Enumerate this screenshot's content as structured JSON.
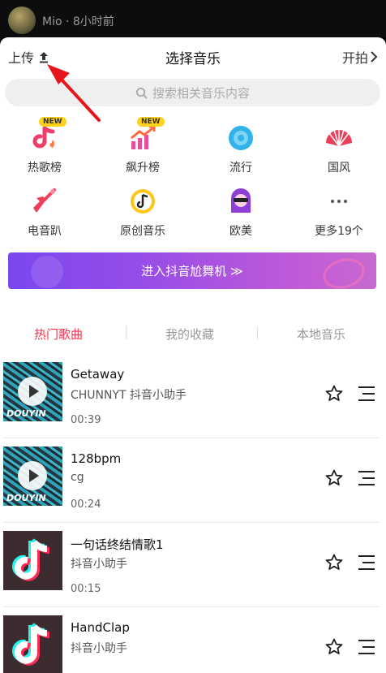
{
  "topbar": {
    "username": "Mio · 8小时前"
  },
  "header": {
    "upload_label": "上传",
    "title": "选择音乐",
    "start_label": "开拍"
  },
  "search": {
    "placeholder": "搜索相关音乐内容"
  },
  "categories": [
    {
      "label": "热歌榜",
      "badge": "NEW",
      "icon": "hot-chart-icon"
    },
    {
      "label": "飙升榜",
      "badge": "NEW",
      "icon": "rising-chart-icon"
    },
    {
      "label": "流行",
      "icon": "pop-icon"
    },
    {
      "label": "国风",
      "icon": "chinese-fan-icon"
    },
    {
      "label": "电音趴",
      "icon": "guitar-icon"
    },
    {
      "label": "原创音乐",
      "icon": "original-music-icon"
    },
    {
      "label": "欧美",
      "icon": "western-icon"
    },
    {
      "label": "更多19个",
      "icon": "more-icon"
    }
  ],
  "banner": {
    "label": "进入抖音尬舞机 ≫"
  },
  "tabs": [
    {
      "label": "热门歌曲",
      "active": true
    },
    {
      "label": "我的收藏",
      "active": false
    },
    {
      "label": "本地音乐",
      "active": false
    }
  ],
  "songs": [
    {
      "title": "Getaway",
      "artist": "CHUNNYT 抖音小助手",
      "duration": "00:39",
      "cover": "douyin",
      "watermark": "DOUYIN"
    },
    {
      "title": "128bpm",
      "artist": "cg",
      "duration": "00:24",
      "cover": "douyin",
      "watermark": "DOUYIN"
    },
    {
      "title": "一句话终结情歌1",
      "artist": "抖音小助手",
      "duration": "00:15",
      "cover": "tiktok"
    },
    {
      "title": "HandClap",
      "artist": "抖音小助手",
      "duration": "",
      "cover": "tiktok"
    }
  ],
  "colors": {
    "accent": "#f5334f",
    "arrow": "#e8141c",
    "banner_start": "#7b46f0",
    "banner_end": "#c76ad0"
  }
}
